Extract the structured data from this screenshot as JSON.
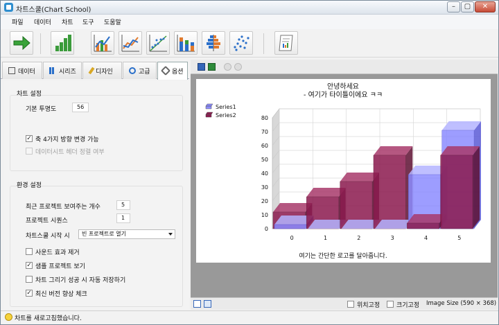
{
  "window": {
    "title": "차트스쿨(Chart School)"
  },
  "menu": [
    "파일",
    "데이터",
    "차트",
    "도구",
    "도움말"
  ],
  "toolbar": {
    "buttons": [
      "next-arrow-icon",
      "bar-chart-icon",
      "combo-chart-icon",
      "line-chart-icon",
      "scatter-trend-icon",
      "stacked-bar-icon",
      "pyramid-chart-icon",
      "scatter-chart-icon",
      "report-icon"
    ]
  },
  "tabs": [
    "데이터",
    "시리즈",
    "디자인",
    "고급",
    "옵션"
  ],
  "options": {
    "chart_settings": {
      "title": "차트 설정",
      "opacity_label": "기본 투명도",
      "opacity_value": "56",
      "rotate_label": "축 4가지 방향 변경 가능",
      "rotate_checked": true,
      "sort_label": "데이터시트 헤더 정렬 여부",
      "sort_checked": false
    },
    "env_settings": {
      "title": "환경 설정",
      "recent_label": "최근 프로젝트 보여주는 개수",
      "recent_value": "5",
      "sequence_label": "프로젝트 시퀀스",
      "sequence_value": "1",
      "start_label": "차트스쿨 시작 시",
      "start_value": "빈 프로젝트로 열기",
      "checks": [
        {
          "label": "사운드 효과 제거",
          "checked": false
        },
        {
          "label": "샘플 프로젝트 보기",
          "checked": true
        },
        {
          "label": "차트 그리기 성공 시 자동 저장하기",
          "checked": false
        },
        {
          "label": "최신 버전 향상 체크",
          "checked": true
        }
      ]
    }
  },
  "bottom": {
    "pin_label": "위치고정",
    "size_lock_label": "크기고정",
    "image_size": "Image Size (590 × 368)"
  },
  "status": {
    "message": "차트를 새로고침했습니다."
  },
  "chart_data": {
    "type": "bar",
    "title": "안녕하세요",
    "subtitle": "- 여기가 타이틀이에요 ㅋㅋ",
    "footer": "여기는 간단한 로고를 달아줍니다.",
    "categories": [
      "0",
      "1",
      "2",
      "3",
      "4",
      "5"
    ],
    "series": [
      {
        "name": "Series1",
        "values": [
          3,
          0,
          0,
          0,
          39,
          71
        ],
        "color": "#8c8cff"
      },
      {
        "name": "Series2",
        "values": [
          12,
          23,
          34,
          53,
          4,
          53
        ],
        "color": "#8b1a4e"
      }
    ],
    "ylim": [
      0,
      80
    ],
    "yticks": [
      "0",
      "10",
      "20",
      "30",
      "40",
      "50",
      "60",
      "70",
      "80"
    ],
    "legend": "top-left",
    "style": "3d"
  }
}
